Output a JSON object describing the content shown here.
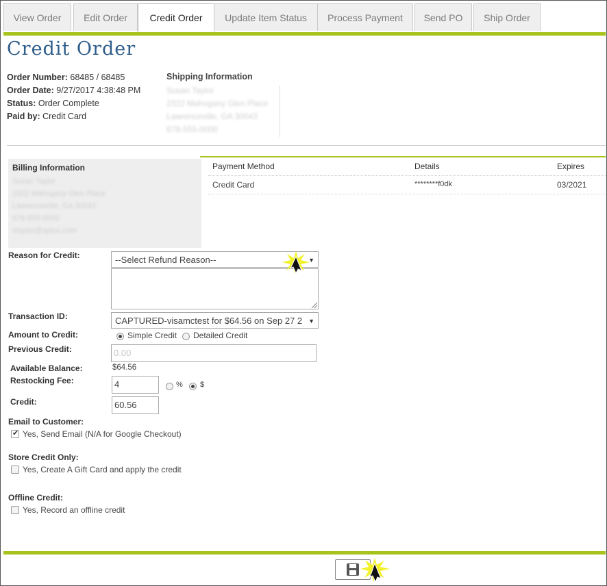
{
  "tabs": [
    {
      "label": "View Order"
    },
    {
      "label": "Edit Order"
    },
    {
      "label": "Credit Order"
    },
    {
      "label": "Update Item Status"
    },
    {
      "label": "Process Payment"
    },
    {
      "label": "Send PO"
    },
    {
      "label": "Ship Order"
    }
  ],
  "page_title": "Credit Order",
  "order": {
    "number_label": "Order Number:",
    "number_value": "68485 / 68485",
    "date_label": "Order Date:",
    "date_value": "9/27/2017 4:38:48 PM",
    "status_label": "Status:",
    "status_value": "Order Complete",
    "paid_label": "Paid by:",
    "paid_value": "Credit Card"
  },
  "shipping": {
    "heading": "Shipping Information",
    "lines": [
      "Susan Taylor",
      "2322 Mahogany Glen Place",
      "Lawrenceville, GA 30043",
      "678-555-0000"
    ]
  },
  "billing": {
    "heading": "Billing Information",
    "lines": [
      "Susan Taylor",
      "2322 Mahogany Glen Place",
      "Lawrenceville, GA 30043",
      "678-555-0000",
      "staylor@aplus.com"
    ]
  },
  "payment": {
    "headers": [
      "Payment Method",
      "Details",
      "Expires"
    ],
    "row": [
      "Credit Card",
      "********f0dk",
      "03/2021"
    ]
  },
  "form": {
    "reason_label": "Reason for Credit:",
    "reason_selected": "--Select Refund Reason--",
    "transaction_label": "Transaction ID:",
    "transaction_selected": "CAPTURED-visamctest for $64.56 on Sep 27 2",
    "amount_label": "Amount to Credit:",
    "amount_option_simple": "Simple Credit",
    "amount_option_detailed": "Detailed Credit",
    "previous_label": "Previous Credit:",
    "previous_value": "0.00",
    "available_label": "Available Balance:",
    "available_value": "$64.56",
    "restocking_label": "Restocking Fee:",
    "restocking_value": "4",
    "percent_symbol": "%",
    "dollar_symbol": "$",
    "credit_label": "Credit:",
    "credit_value": "60.56",
    "email_label": "Email to Customer:",
    "email_option": "Yes, Send Email (N/A for Google Checkout)",
    "store_label": "Store Credit Only:",
    "store_option": "Yes, Create A Gift Card and apply the credit",
    "offline_label": "Offline Credit:",
    "offline_option": "Yes, Record an offline credit"
  },
  "colors": {
    "accent_green": "#a8c41c",
    "title_blue": "#2e5d8a"
  }
}
